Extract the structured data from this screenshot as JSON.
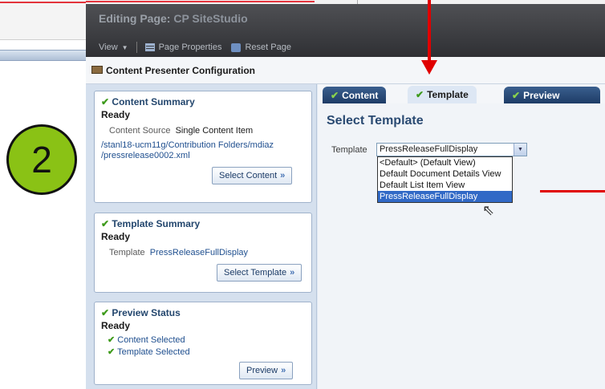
{
  "step_number": "2",
  "window": {
    "title_prefix": "Editing Page:",
    "title_name": "CP SiteStudio",
    "toolbar": {
      "view_label": "View",
      "page_properties_label": "Page Properties",
      "reset_page_label": "Reset Page"
    }
  },
  "config_title": "Content Presenter Configuration",
  "left_panel": {
    "content_summary": {
      "title": "Content Summary",
      "status": "Ready",
      "source_label": "Content Source",
      "source_value": "Single Content Item",
      "path_line1": "/stanl18-ucm11g/Contribution Folders/mdiaz",
      "path_line2": "/pressrelease0002.xml",
      "button_label": "Select Content"
    },
    "template_summary": {
      "title": "Template Summary",
      "status": "Ready",
      "template_label": "Template",
      "template_value": "PressReleaseFullDisplay",
      "button_label": "Select Template"
    },
    "preview_status": {
      "title": "Preview Status",
      "status": "Ready",
      "items": [
        "Content Selected",
        "Template Selected"
      ],
      "button_label": "Preview"
    }
  },
  "tabs": [
    {
      "label": "Content",
      "active": false
    },
    {
      "label": "Template",
      "active": true
    },
    {
      "label": "Preview",
      "active": false
    }
  ],
  "main": {
    "heading": "Select Template",
    "template_field_label": "Template",
    "template_selected": "PressReleaseFullDisplay",
    "dropdown_options": [
      "<Default> (Default View)",
      "Default Document Details View",
      "Default List Item View",
      "PressReleaseFullDisplay"
    ],
    "highlighted_option": "PressReleaseFullDisplay"
  },
  "colors": {
    "step_circle": "#8ac215",
    "annotation_red": "#e00000",
    "tab_dark": "#1e3c66",
    "selection_blue": "#3169c6"
  }
}
